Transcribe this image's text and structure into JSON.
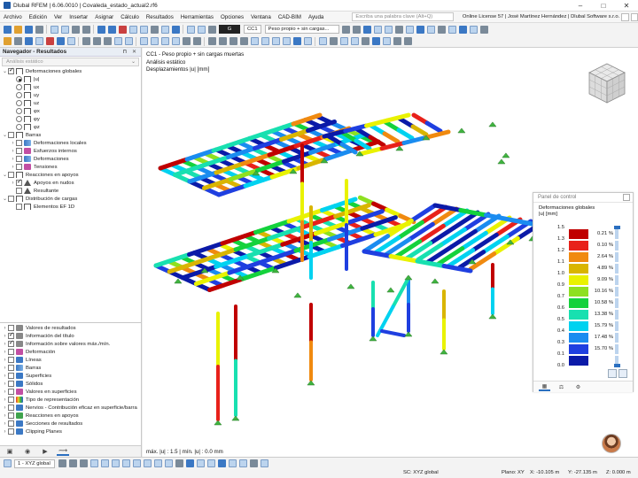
{
  "window": {
    "title": "Dlubal RFEM | 6.06.0010 | Covaleda_estado_actual2.rf6",
    "buttons": [
      "–",
      "□",
      "✕"
    ]
  },
  "menu": {
    "items": [
      "Archivo",
      "Edición",
      "Ver",
      "Insertar",
      "Asignar",
      "Cálculo",
      "Resultados",
      "Herramientas",
      "Opciones",
      "Ventana",
      "CAD-BIM",
      "Ayuda"
    ],
    "search_placeholder": "Escriba una palabra clave (Alt+Q)",
    "license": "Online License 57 | José Martínez Hernández | Dlubal Software s.r.o."
  },
  "toolbar": {
    "case_code": "G",
    "case_id": "CC1",
    "case_name": "Peso propio + sin cargas..."
  },
  "navigator": {
    "title": "Navegador - Resultados",
    "analysis_type": "Análisis estático",
    "results_tree": [
      {
        "label": "Deformaciones globales",
        "level": 0,
        "expand": "⌄",
        "control": "cb-on",
        "icon": "frame"
      },
      {
        "label": "|u|",
        "level": 1,
        "control": "rb-on",
        "icon": "frame"
      },
      {
        "label": "ux",
        "level": 1,
        "control": "rb",
        "icon": "frame"
      },
      {
        "label": "uy",
        "level": 1,
        "control": "rb",
        "icon": "frame"
      },
      {
        "label": "uz",
        "level": 1,
        "control": "rb",
        "icon": "frame"
      },
      {
        "label": "φx",
        "level": 1,
        "control": "rb",
        "icon": "frame"
      },
      {
        "label": "φy",
        "level": 1,
        "control": "rb",
        "icon": "frame"
      },
      {
        "label": "φz",
        "level": 1,
        "control": "rb",
        "icon": "frame"
      },
      {
        "label": "Barras",
        "level": 0,
        "expand": "⌄",
        "control": "cb",
        "icon": "frame"
      },
      {
        "label": "Deformaciones locales",
        "level": 1,
        "expand": "›",
        "control": "cb",
        "icon": "beam"
      },
      {
        "label": "Esfuerzos internos",
        "level": 1,
        "expand": "›",
        "control": "cb",
        "icon": "pink"
      },
      {
        "label": "Deformaciones",
        "level": 1,
        "expand": "›",
        "control": "cb",
        "icon": "beam"
      },
      {
        "label": "Tensiones",
        "level": 1,
        "expand": "›",
        "control": "cb",
        "icon": "pink"
      },
      {
        "label": "Reacciones en apoyos",
        "level": 0,
        "expand": "⌄",
        "control": "cb",
        "icon": "frame"
      },
      {
        "label": "Apoyos en nudos",
        "level": 1,
        "expand": "›",
        "control": "cb-on",
        "icon": "react"
      },
      {
        "label": "Resultante",
        "level": 1,
        "control": "cb",
        "icon": "react"
      },
      {
        "label": "Distribución de cargas",
        "level": 0,
        "expand": "⌄",
        "control": "cb",
        "icon": "frame"
      },
      {
        "label": "Elementos EF 1D",
        "level": 1,
        "control": "cb",
        "icon": "frame"
      }
    ],
    "display_tree": [
      {
        "label": "Valores de resultados",
        "control": "cb",
        "icon": "grey"
      },
      {
        "label": "Información del título",
        "control": "cb-on",
        "icon": "grey"
      },
      {
        "label": "Información sobre valores máx./mín.",
        "control": "cb-on",
        "icon": "grey"
      },
      {
        "label": "Deformación",
        "control": "none",
        "icon": "pink"
      },
      {
        "label": "Líneas",
        "control": "none",
        "icon": "blue"
      },
      {
        "label": "Barras",
        "control": "none",
        "icon": "beam"
      },
      {
        "label": "Superficies",
        "control": "none",
        "icon": "blue"
      },
      {
        "label": "Sólidos",
        "control": "none",
        "icon": "blue"
      },
      {
        "label": "Valores en superficies",
        "control": "none",
        "icon": "pink"
      },
      {
        "label": "Tipo de representación",
        "control": "none",
        "icon": "multi"
      },
      {
        "label": "Nervios - Contribución eficaz en superficie/barra",
        "control": "none",
        "icon": "blue"
      },
      {
        "label": "Reacciones en apoyos",
        "control": "none",
        "icon": "green"
      },
      {
        "label": "Secciones de resultados",
        "control": "none",
        "icon": "blue"
      },
      {
        "label": "Clipping Planes",
        "control": "none",
        "icon": "blue"
      }
    ]
  },
  "viewport": {
    "info": [
      "CC1 - Peso propio + sin cargas muertas",
      "Análisis estático",
      "Desplazamientos |u| [mm]"
    ],
    "footer": "máx. |u| : 1.5 | mín. |u| : 0.0 mm"
  },
  "control_panel": {
    "title": "Panel de control",
    "heading": "Deformaciones globales",
    "unit": "|u| [mm]",
    "legend": [
      {
        "value": "1.5",
        "color": "#c00000",
        "percent": "0.21 %"
      },
      {
        "value": "1.3",
        "color": "#e8211a",
        "percent": "0.10 %"
      },
      {
        "value": "1.2",
        "color": "#f08a10",
        "percent": "2.64 %"
      },
      {
        "value": "1.1",
        "color": "#d9b500",
        "percent": "4.89 %"
      },
      {
        "value": "1.0",
        "color": "#e9f200",
        "percent": "9.09 %"
      },
      {
        "value": "0.9",
        "color": "#8ee020",
        "percent": "10.16 %"
      },
      {
        "value": "0.7",
        "color": "#14d23c",
        "percent": "10.58 %"
      },
      {
        "value": "0.6",
        "color": "#18e0b0",
        "percent": "13.38 %"
      },
      {
        "value": "0.5",
        "color": "#00d2f0",
        "percent": "15.79 %"
      },
      {
        "value": "0.4",
        "color": "#1a8cf0",
        "percent": "17.48 %"
      },
      {
        "value": "0.3",
        "color": "#1f3fe0",
        "percent": "15.70 %"
      },
      {
        "value": "0.1",
        "color": "#0b1aa8"
      },
      {
        "value": "0.0"
      }
    ]
  },
  "statusbar": {
    "view_selector": "1 - XYZ global",
    "coord_system": "SC: XYZ global",
    "plane": "Plano: XY",
    "x": "X: -10.105 m",
    "y": "Y: -27.135 m",
    "z": "Z: 0.000 m"
  },
  "colors": {
    "accent": "#2a6fc0",
    "support_green": "#3fb33f"
  }
}
